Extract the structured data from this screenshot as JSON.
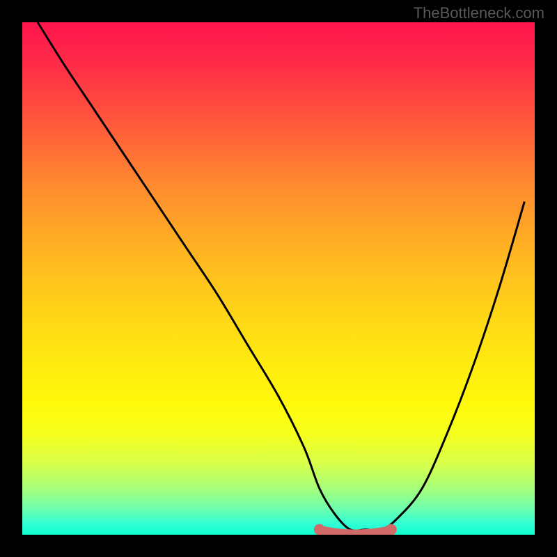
{
  "watermark": "TheBottleneck.com",
  "chart_data": {
    "type": "line",
    "title": "",
    "xlabel": "",
    "ylabel": "",
    "xlim": [
      0,
      100
    ],
    "ylim": [
      0,
      100
    ],
    "background_gradient": {
      "top": "#ff144c",
      "mid": "#ffe20f",
      "bottom": "#12ffd0"
    },
    "series": [
      {
        "name": "bottleneck-curve",
        "x": [
          3,
          8,
          14,
          20,
          26,
          32,
          38,
          44,
          50,
          55,
          58,
          61,
          64,
          67,
          70,
          73,
          78,
          83,
          88,
          93,
          98
        ],
        "values": [
          100,
          92,
          83,
          74,
          65,
          56,
          47,
          37,
          27,
          17,
          9,
          4,
          1,
          1,
          1,
          3,
          9,
          20,
          33,
          48,
          65
        ]
      }
    ],
    "highlight": {
      "name": "optimal-range",
      "x_start": 58,
      "x_end": 72,
      "y": 1,
      "color": "#d26a6a"
    }
  }
}
